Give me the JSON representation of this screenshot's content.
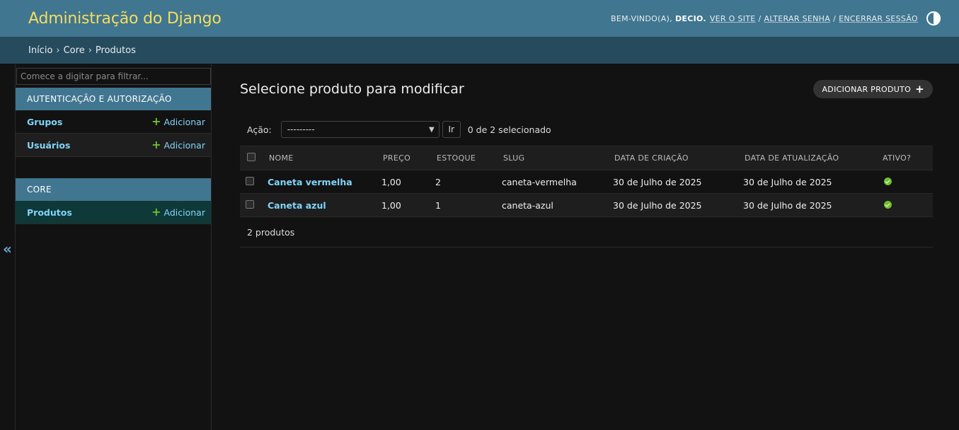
{
  "header": {
    "site_title": "Administração do Django",
    "welcome": "BEM-VINDO(A),",
    "username": "DECIO.",
    "view_site": "VER O SITE",
    "change_password": "ALTERAR SENHA",
    "logout": "ENCERRAR SESSÃO",
    "separator": "/",
    "theme_icon": "half-circle-icon"
  },
  "breadcrumbs": [
    "Início",
    "Core",
    "Produtos"
  ],
  "breadcrumb_separator": "›",
  "sidebar": {
    "toggle": "«",
    "filter_placeholder": "Comece a digitar para filtrar...",
    "modules": [
      {
        "caption": "AUTENTICAÇÃO E AUTORIZAÇÃO",
        "models": [
          {
            "name": "Grupos",
            "add": "Adicionar"
          },
          {
            "name": "Usuários",
            "add": "Adicionar"
          }
        ]
      },
      {
        "caption": "CORE",
        "models": [
          {
            "name": "Produtos",
            "add": "Adicionar"
          }
        ]
      }
    ]
  },
  "content": {
    "title": "Selecione produto para modificar",
    "add_button": "ADICIONAR PRODUTO",
    "action_label": "Ação:",
    "action_selected": "---------",
    "go_button": "Ir",
    "counter": "0 de 2 selecionado",
    "columns": [
      "NOME",
      "PREÇO",
      "ESTOQUE",
      "SLUG",
      "DATA DE CRIAÇÃO",
      "DATA DE ATUALIZAÇÃO",
      "ATIVO?"
    ],
    "rows": [
      {
        "nome": "Caneta vermelha",
        "preco": "1,00",
        "estoque": "2",
        "slug": "caneta-vermelha",
        "criacao": "30 de Julho de 2025",
        "atualizacao": "30 de Julho de 2025",
        "ativo": true
      },
      {
        "nome": "Caneta azul",
        "preco": "1,00",
        "estoque": "1",
        "slug": "caneta-azul",
        "criacao": "30 de Julho de 2025",
        "atualizacao": "30 de Julho de 2025",
        "ativo": true
      }
    ],
    "paginator": "2 produtos"
  },
  "colors": {
    "header_bg": "#417690",
    "title_yellow": "#f5dd5d",
    "breadcrumb_bg": "#264b5d",
    "link_blue": "#81d4fa",
    "add_green": "#70bf2b",
    "current_row": "#0f3838"
  }
}
